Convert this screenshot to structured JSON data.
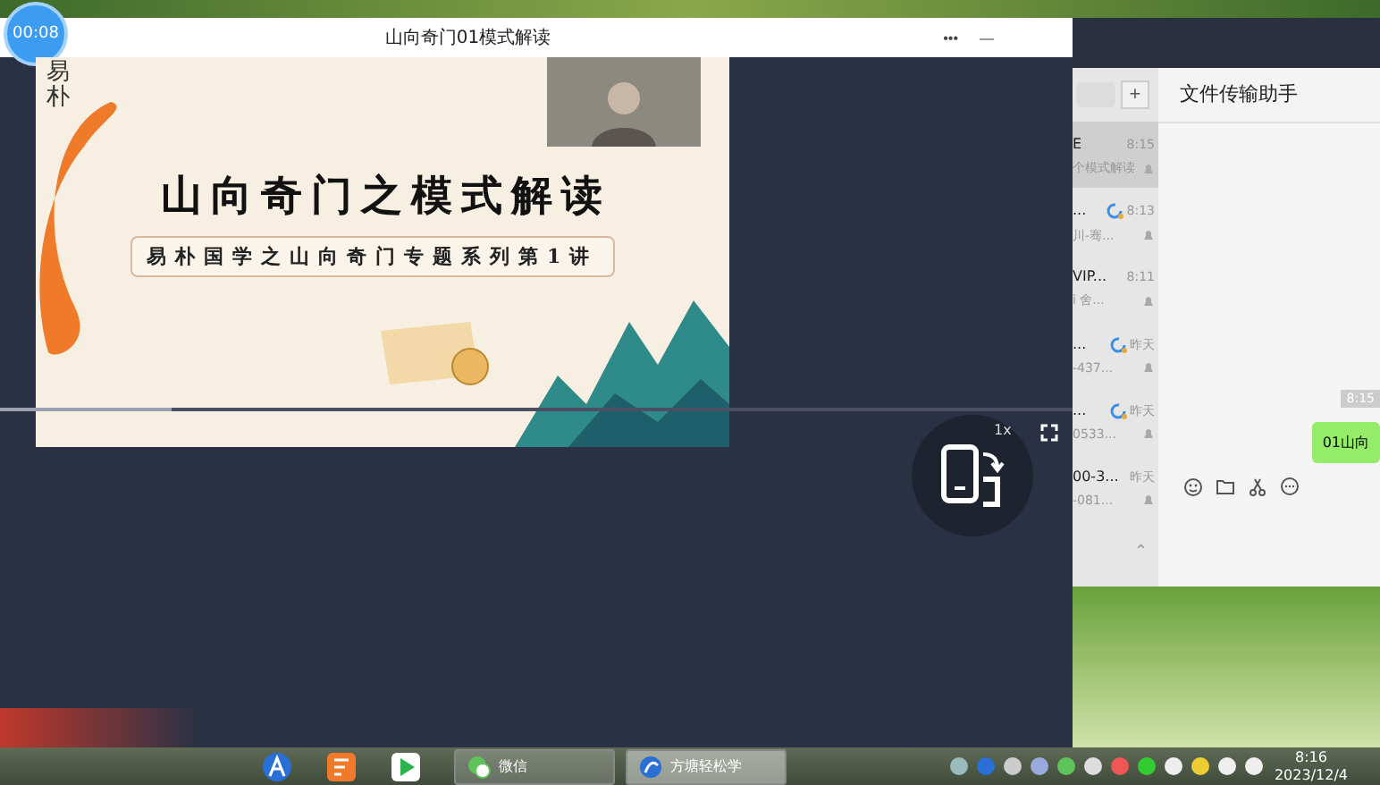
{
  "player": {
    "timer": "00:08",
    "title": "山向奇门01模式解读",
    "window_buttons": [
      "•••",
      "—"
    ],
    "speed": "1x",
    "progress": {
      "level": 0.16
    },
    "slide": {
      "logo": "易朴",
      "title": "山向奇门之模式解读",
      "subtitle": "易朴国学之山向奇门专题系列第1讲"
    }
  },
  "chat": {
    "add_button": "+",
    "header": "文件传输助手",
    "contacts": [
      {
        "name": "E",
        "time": "8:15",
        "preview": "个模式解读",
        "selected": true,
        "badge": false
      },
      {
        "name": "...",
        "time": "8:13",
        "preview": "川-骞...",
        "selected": false,
        "badge": true
      },
      {
        "name": "VIP...",
        "time": "8:11",
        "preview": "i 舍...",
        "selected": false,
        "badge": false
      },
      {
        "name": "...",
        "time": "昨天",
        "preview": "-437...",
        "selected": false,
        "badge": true
      },
      {
        "name": "...",
        "time": "昨天",
        "preview": "0533...",
        "selected": false,
        "badge": true
      },
      {
        "name": "00-3...",
        "time": "昨天",
        "preview": "-081...",
        "selected": false,
        "badge": false
      }
    ],
    "collapse_button": "⌃",
    "messages": [
      {
        "time": "8:15",
        "text": "01山向"
      }
    ]
  },
  "taskbar": {
    "windows": [
      {
        "label": "微信",
        "selected": false
      },
      {
        "label": "方塘轻松学",
        "selected": true
      }
    ],
    "time": "8:16",
    "date": "2023/12/4"
  }
}
